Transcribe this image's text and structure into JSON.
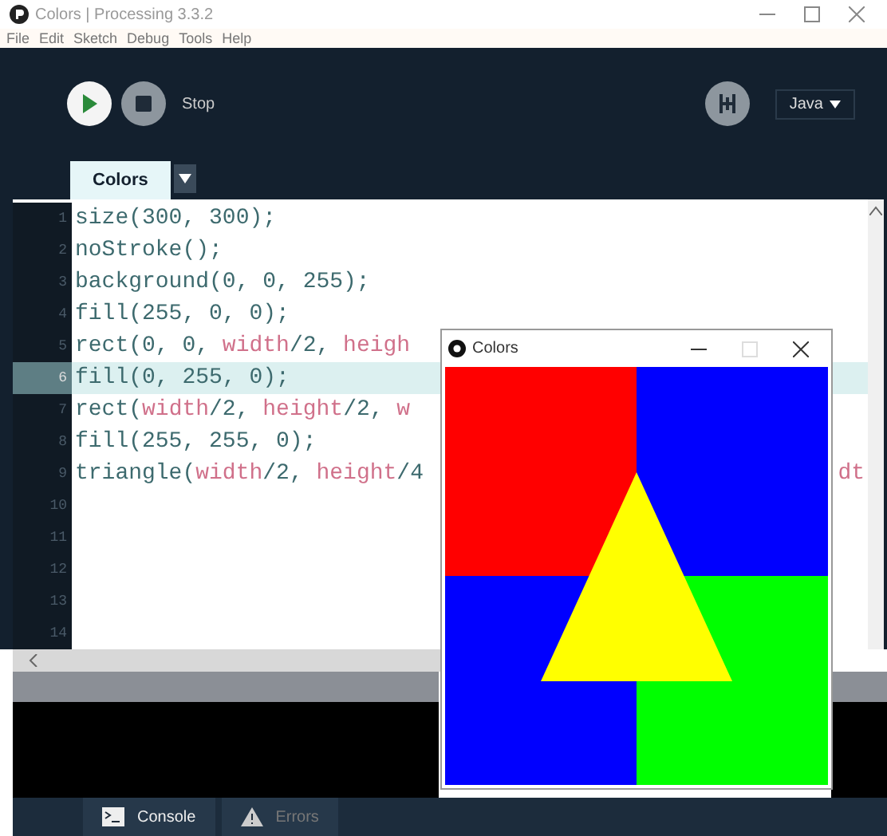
{
  "window": {
    "title": "Colors | Processing 3.3.2",
    "menu": [
      "File",
      "Edit",
      "Sketch",
      "Debug",
      "Tools",
      "Help"
    ]
  },
  "toolbar": {
    "stop_label": "Stop",
    "mode": "Java"
  },
  "tabs": [
    {
      "label": "Colors",
      "selected": true
    }
  ],
  "editor": {
    "lines": [
      {
        "number": "1",
        "selected": false,
        "tokens": [
          {
            "kind": "plain",
            "text": "size(300, 300);"
          }
        ]
      },
      {
        "number": "2",
        "selected": false,
        "tokens": [
          {
            "kind": "plain",
            "text": "noStroke();"
          }
        ]
      },
      {
        "number": "3",
        "selected": false,
        "tokens": [
          {
            "kind": "plain",
            "text": "background(0, 0, 255);"
          }
        ]
      },
      {
        "number": "4",
        "selected": false,
        "tokens": [
          {
            "kind": "plain",
            "text": "fill(255, 0, 0);"
          }
        ]
      },
      {
        "number": "5",
        "selected": false,
        "tokens": [
          {
            "kind": "plain",
            "text": "rect(0, 0, "
          },
          {
            "kind": "var",
            "text": "width"
          },
          {
            "kind": "plain",
            "text": "/2, "
          },
          {
            "kind": "var",
            "text": "heigh"
          }
        ]
      },
      {
        "number": "6",
        "selected": true,
        "tokens": [
          {
            "kind": "plain",
            "text": "fill(0, 255, 0);"
          }
        ]
      },
      {
        "number": "7",
        "selected": false,
        "tokens": [
          {
            "kind": "plain",
            "text": "rect("
          },
          {
            "kind": "var",
            "text": "width"
          },
          {
            "kind": "plain",
            "text": "/2, "
          },
          {
            "kind": "var",
            "text": "height"
          },
          {
            "kind": "plain",
            "text": "/2, "
          },
          {
            "kind": "var",
            "text": "w"
          }
        ]
      },
      {
        "number": "8",
        "selected": false,
        "tokens": [
          {
            "kind": "plain",
            "text": "fill(255, 255, 0);"
          }
        ]
      },
      {
        "number": "9",
        "selected": false,
        "tokens": [
          {
            "kind": "plain",
            "text": "triangle("
          },
          {
            "kind": "var",
            "text": "width"
          },
          {
            "kind": "plain",
            "text": "/2, "
          },
          {
            "kind": "var",
            "text": "height"
          },
          {
            "kind": "plain",
            "text": "/4"
          }
        ],
        "tail": "dt"
      },
      {
        "number": "10",
        "selected": false
      },
      {
        "number": "11",
        "selected": false
      },
      {
        "number": "12",
        "selected": false
      },
      {
        "number": "13",
        "selected": false
      },
      {
        "number": "14",
        "selected": false
      }
    ]
  },
  "sketch_window": {
    "title": "Colors"
  },
  "bottom_tabs": [
    {
      "label": "Console",
      "selected": true,
      "kind": "console"
    },
    {
      "label": "Errors",
      "selected": false,
      "kind": "errors"
    }
  ]
}
